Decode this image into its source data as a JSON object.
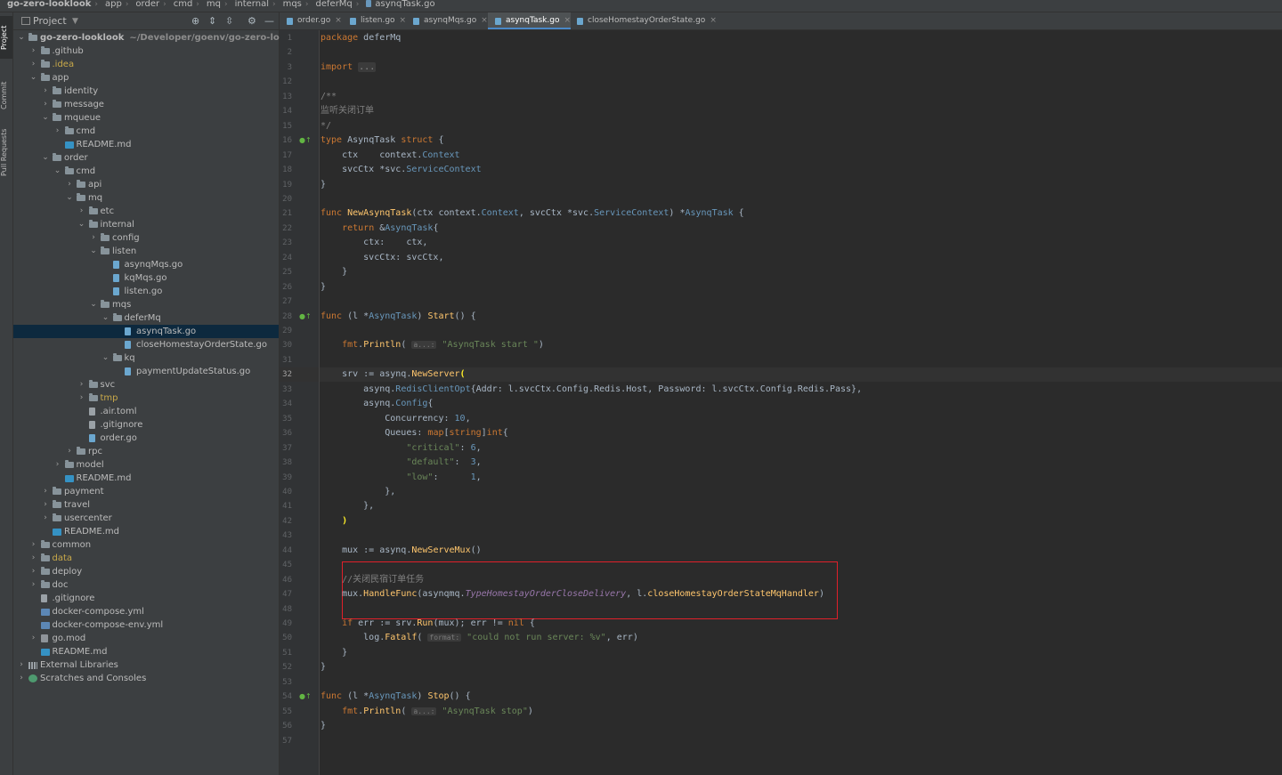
{
  "breadcrumb": [
    "go-zero-looklook",
    "app",
    "order",
    "cmd",
    "mq",
    "internal",
    "mqs",
    "deferMq",
    "asynqTask.go"
  ],
  "left_strip": {
    "project": "Project",
    "commit": "Commit",
    "pull_requests": "Pull Requests"
  },
  "project_panel": {
    "title": "Project"
  },
  "tree": [
    {
      "label": "go-zero-looklook",
      "depth": 0,
      "open": true,
      "icon": "folder-icon",
      "path": "~/Developer/goenv/go-zero-looklook",
      "bold": true
    },
    {
      "label": ".github",
      "depth": 1,
      "open": false,
      "icon": "folder-icon"
    },
    {
      "label": ".idea",
      "depth": 1,
      "open": false,
      "icon": "folder-icon",
      "ignored": true
    },
    {
      "label": "app",
      "depth": 1,
      "open": true,
      "icon": "folder-icon"
    },
    {
      "label": "identity",
      "depth": 2,
      "open": false,
      "icon": "folder-icon"
    },
    {
      "label": "message",
      "depth": 2,
      "open": false,
      "icon": "folder-icon"
    },
    {
      "label": "mqueue",
      "depth": 2,
      "open": true,
      "icon": "folder-icon"
    },
    {
      "label": "cmd",
      "depth": 3,
      "open": false,
      "icon": "folder-icon"
    },
    {
      "label": "README.md",
      "depth": 3,
      "icon": "markdown-file-icon"
    },
    {
      "label": "order",
      "depth": 2,
      "open": true,
      "icon": "folder-icon"
    },
    {
      "label": "cmd",
      "depth": 3,
      "open": true,
      "icon": "folder-icon"
    },
    {
      "label": "api",
      "depth": 4,
      "open": false,
      "icon": "folder-icon"
    },
    {
      "label": "mq",
      "depth": 4,
      "open": true,
      "icon": "folder-icon"
    },
    {
      "label": "etc",
      "depth": 5,
      "open": false,
      "icon": "folder-icon"
    },
    {
      "label": "internal",
      "depth": 5,
      "open": true,
      "icon": "folder-icon"
    },
    {
      "label": "config",
      "depth": 6,
      "open": false,
      "icon": "folder-icon"
    },
    {
      "label": "listen",
      "depth": 6,
      "open": true,
      "icon": "folder-icon"
    },
    {
      "label": "asynqMqs.go",
      "depth": 7,
      "icon": "go-file-icon"
    },
    {
      "label": "kqMqs.go",
      "depth": 7,
      "icon": "go-file-icon"
    },
    {
      "label": "listen.go",
      "depth": 7,
      "icon": "go-file-icon"
    },
    {
      "label": "mqs",
      "depth": 6,
      "open": true,
      "icon": "folder-icon"
    },
    {
      "label": "deferMq",
      "depth": 7,
      "open": true,
      "icon": "folder-icon"
    },
    {
      "label": "asynqTask.go",
      "depth": 8,
      "icon": "go-file-icon",
      "selected": true
    },
    {
      "label": "closeHomestayOrderState.go",
      "depth": 8,
      "icon": "go-file-icon"
    },
    {
      "label": "kq",
      "depth": 7,
      "open": true,
      "icon": "folder-icon"
    },
    {
      "label": "paymentUpdateStatus.go",
      "depth": 8,
      "icon": "go-file-icon"
    },
    {
      "label": "svc",
      "depth": 5,
      "open": false,
      "icon": "folder-icon"
    },
    {
      "label": "tmp",
      "depth": 5,
      "open": false,
      "icon": "folder-icon",
      "ignored": true
    },
    {
      "label": ".air.toml",
      "depth": 5,
      "icon": "text-file-icon"
    },
    {
      "label": ".gitignore",
      "depth": 5,
      "icon": "text-file-icon"
    },
    {
      "label": "order.go",
      "depth": 5,
      "icon": "go-file-icon"
    },
    {
      "label": "rpc",
      "depth": 4,
      "open": false,
      "icon": "folder-icon"
    },
    {
      "label": "model",
      "depth": 3,
      "open": false,
      "icon": "folder-icon"
    },
    {
      "label": "README.md",
      "depth": 3,
      "icon": "markdown-file-icon"
    },
    {
      "label": "payment",
      "depth": 2,
      "open": false,
      "icon": "folder-icon"
    },
    {
      "label": "travel",
      "depth": 2,
      "open": false,
      "icon": "folder-icon"
    },
    {
      "label": "usercenter",
      "depth": 2,
      "open": false,
      "icon": "folder-icon"
    },
    {
      "label": "README.md",
      "depth": 2,
      "icon": "markdown-file-icon"
    },
    {
      "label": "common",
      "depth": 1,
      "open": false,
      "icon": "folder-icon"
    },
    {
      "label": "data",
      "depth": 1,
      "open": false,
      "icon": "folder-icon",
      "ignored": true
    },
    {
      "label": "deploy",
      "depth": 1,
      "open": false,
      "icon": "folder-icon"
    },
    {
      "label": "doc",
      "depth": 1,
      "open": false,
      "icon": "folder-icon"
    },
    {
      "label": ".gitignore",
      "depth": 1,
      "icon": "text-file-icon"
    },
    {
      "label": "docker-compose.yml",
      "depth": 1,
      "icon": "yaml-file-icon"
    },
    {
      "label": "docker-compose-env.yml",
      "depth": 1,
      "icon": "yaml-file-icon"
    },
    {
      "label": "go.mod",
      "depth": 1,
      "open": false,
      "icon": "go-mod-icon"
    },
    {
      "label": "README.md",
      "depth": 1,
      "icon": "markdown-file-icon"
    },
    {
      "label": "External Libraries",
      "depth": 0,
      "open": false,
      "icon": "library-icon"
    },
    {
      "label": "Scratches and Consoles",
      "depth": 0,
      "open": false,
      "icon": "scratch-icon"
    }
  ],
  "tabs": [
    {
      "label": "order.go",
      "active": false
    },
    {
      "label": "listen.go",
      "active": false
    },
    {
      "label": "asynqMqs.go",
      "active": false
    },
    {
      "label": "asynqTask.go",
      "active": true
    },
    {
      "label": "closeHomestayOrderState.go",
      "active": false
    }
  ],
  "editor": {
    "current_line": 32,
    "lines": [
      {
        "n": "1",
        "h": "<span class=\"kw\">package</span> deferMq"
      },
      {
        "n": "2",
        "h": ""
      },
      {
        "n": "3",
        "h": "<span class=\"kw\">import</span> <span class=\"fold\">...</span>"
      },
      {
        "n": "12",
        "h": ""
      },
      {
        "n": "13",
        "h": "<span class=\"cmt\">/**</span>"
      },
      {
        "n": "14",
        "h": "<span class=\"cmt\">监听关闭订单</span>"
      },
      {
        "n": "15",
        "h": "<span class=\"cmt\">*/</span>"
      },
      {
        "n": "16",
        "h": "<span class=\"kw\">type</span> AsynqTask <span class=\"kw\">struct</span> {",
        "mark": true
      },
      {
        "n": "17",
        "h": "    ctx    context.<span class=\"ty\">Context</span>"
      },
      {
        "n": "18",
        "h": "    svcCtx *svc.<span class=\"ty\">ServiceContext</span>"
      },
      {
        "n": "19",
        "h": "}"
      },
      {
        "n": "20",
        "h": ""
      },
      {
        "n": "21",
        "h": "<span class=\"kw\">func</span> <span class=\"fn\">NewAsynqTask</span>(ctx context.<span class=\"ty\">Context</span>, svcCtx *svc.<span class=\"ty\">ServiceContext</span>) *<span class=\"ty\">AsynqTask</span> {"
      },
      {
        "n": "22",
        "h": "    <span class=\"kw\">return</span> &amp;<span class=\"ty\">AsynqTask</span>{"
      },
      {
        "n": "23",
        "h": "        ctx:    ctx,"
      },
      {
        "n": "24",
        "h": "        svcCtx: svcCtx,"
      },
      {
        "n": "25",
        "h": "    }"
      },
      {
        "n": "26",
        "h": "}"
      },
      {
        "n": "27",
        "h": ""
      },
      {
        "n": "28",
        "h": "<span class=\"kw\">func</span> (l *<span class=\"ty\">AsynqTask</span>) <span class=\"fn\">Start</span>() {",
        "mark": true
      },
      {
        "n": "29",
        "h": ""
      },
      {
        "n": "30",
        "h": "    <span class=\"pk\">fmt</span>.<span class=\"fn\">Println</span>( <span class=\"hint\">a...:</span> <span class=\"str\">\"AsynqTask start \"</span>)"
      },
      {
        "n": "31",
        "h": ""
      },
      {
        "n": "32",
        "h": "    srv := asynq.<span class=\"fn\">NewServer</span><span class=\"brace-hl\">(</span>"
      },
      {
        "n": "33",
        "h": "        asynq.<span class=\"ty\">RedisClientOpt</span>{Addr: l.svcCtx.Config.Redis.Host, Password: l.svcCtx.Config.Redis.Pass},"
      },
      {
        "n": "34",
        "h": "        asynq.<span class=\"ty\">Config</span>{"
      },
      {
        "n": "35",
        "h": "            Concurrency: <span class=\"num\">10</span>,"
      },
      {
        "n": "36",
        "h": "            Queues: <span class=\"kw\">map</span>[<span class=\"kw\">string</span>]<span class=\"kw\">int</span>{"
      },
      {
        "n": "37",
        "h": "                <span class=\"str\">\"critical\"</span>: <span class=\"num\">6</span>,"
      },
      {
        "n": "38",
        "h": "                <span class=\"str\">\"default\"</span>:  <span class=\"num\">3</span>,"
      },
      {
        "n": "39",
        "h": "                <span class=\"str\">\"low\"</span>:      <span class=\"num\">1</span>,"
      },
      {
        "n": "40",
        "h": "            },"
      },
      {
        "n": "41",
        "h": "        },"
      },
      {
        "n": "42",
        "h": "    <span class=\"brace-hl\">)</span>"
      },
      {
        "n": "43",
        "h": ""
      },
      {
        "n": "44",
        "h": "    mux := asynq.<span class=\"fn\">NewServeMux</span>()"
      },
      {
        "n": "45",
        "h": ""
      },
      {
        "n": "46",
        "h": "    <span class=\"cmt\">//关闭民宿订单任务</span>"
      },
      {
        "n": "47",
        "h": "    mux.<span class=\"fn\">HandleFunc</span>(asynqmq.<span class=\"ital\">TypeHomestayOrderCloseDelivery</span>, l.<span class=\"fn\">closeHomestayOrderStateMqHandler</span>)"
      },
      {
        "n": "48",
        "h": ""
      },
      {
        "n": "49",
        "h": "    <span class=\"kw\">if</span> err := srv.<span class=\"fn\">Run</span>(mux); err != <span class=\"kw\">nil</span> {"
      },
      {
        "n": "50",
        "h": "        log.<span class=\"fn\">Fatalf</span>( <span class=\"hint\">format:</span> <span class=\"str\">\"could not run server: %v\"</span>, err)"
      },
      {
        "n": "51",
        "h": "    }"
      },
      {
        "n": "52",
        "h": "}"
      },
      {
        "n": "53",
        "h": ""
      },
      {
        "n": "54",
        "h": "<span class=\"kw\">func</span> (l *<span class=\"ty\">AsynqTask</span>) <span class=\"fn\">Stop</span>() {",
        "mark": true
      },
      {
        "n": "55",
        "h": "    <span class=\"pk\">fmt</span>.<span class=\"fn\">Println</span>( <span class=\"hint\">a...:</span> <span class=\"str\">\"AsynqTask stop\"</span>)"
      },
      {
        "n": "56",
        "h": "}"
      },
      {
        "n": "57",
        "h": ""
      }
    ]
  }
}
